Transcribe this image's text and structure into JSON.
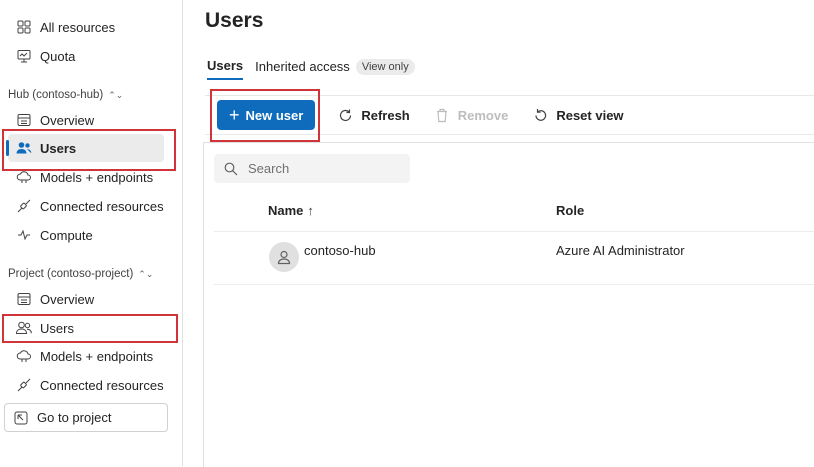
{
  "sidebar": {
    "top_items": [
      {
        "label": "All resources",
        "icon": "grid-icon"
      },
      {
        "label": "Quota",
        "icon": "monitor-icon"
      }
    ],
    "hub_group": "Hub (contoso-hub)",
    "hub_items": [
      {
        "label": "Overview",
        "icon": "overview-icon"
      },
      {
        "label": "Users",
        "icon": "people-icon"
      },
      {
        "label": "Models + endpoints",
        "icon": "cloud-icon"
      },
      {
        "label": "Connected resources",
        "icon": "plug-icon"
      },
      {
        "label": "Compute",
        "icon": "pulse-icon"
      }
    ],
    "project_group": "Project (contoso-project)",
    "project_items": [
      {
        "label": "Overview",
        "icon": "overview-icon"
      },
      {
        "label": "Users",
        "icon": "people-icon"
      },
      {
        "label": "Models + endpoints",
        "icon": "cloud-icon"
      },
      {
        "label": "Connected resources",
        "icon": "plug-icon"
      }
    ],
    "go_to_project": "Go to project"
  },
  "main": {
    "title": "Users",
    "tabs": [
      {
        "label": "Users",
        "active": true
      },
      {
        "label": "Inherited access",
        "active": false
      }
    ],
    "badge": "View only",
    "toolbar": {
      "new_user": "New user",
      "refresh": "Refresh",
      "remove": "Remove",
      "reset_view": "Reset view"
    },
    "search_placeholder": "Search",
    "table": {
      "columns": [
        "Name",
        "Role"
      ],
      "sort_indicator": "↑",
      "rows": [
        {
          "name": "contoso-hub",
          "role": "Azure AI Administrator"
        }
      ]
    }
  },
  "colors": {
    "accent": "#0f6cbd",
    "highlight_box": "#d13438"
  }
}
